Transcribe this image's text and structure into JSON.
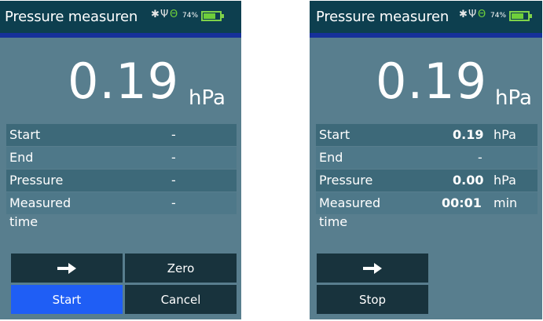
{
  "screens": [
    {
      "title": "Pressure measuren",
      "battery_percent": "74%",
      "battery_level": 0.74,
      "reading_value": "0.19",
      "reading_unit": "hPa",
      "rows": [
        {
          "label": "Start",
          "value": "-",
          "unit": ""
        },
        {
          "label": "End",
          "value": "-",
          "unit": ""
        },
        {
          "label": "Pressure",
          "value": "-",
          "unit": ""
        },
        {
          "label": "Measured",
          "value": "-",
          "unit": ""
        }
      ],
      "row_continuation": "time",
      "buttons": {
        "arrow": "arrow-right-icon",
        "zero": "Zero",
        "start": "Start",
        "cancel": "Cancel"
      }
    },
    {
      "title": "Pressure measuren",
      "battery_percent": "74%",
      "battery_level": 0.74,
      "reading_value": "0.19",
      "reading_unit": "hPa",
      "rows": [
        {
          "label": "Start",
          "value": "0.19",
          "unit": "hPa"
        },
        {
          "label": "End",
          "value": "-",
          "unit": ""
        },
        {
          "label": "Pressure",
          "value": "0.00",
          "unit": "hPa"
        },
        {
          "label": "Measured",
          "value": "00:01",
          "unit": "min"
        }
      ],
      "row_continuation": "time",
      "buttons": {
        "arrow": "arrow-right-icon",
        "stop": "Stop"
      }
    }
  ],
  "colors": {
    "screen_bg": "#587e8e",
    "titlebar": "#0d3f4f",
    "accent_bar": "#16309a",
    "button": "#18333d",
    "button_active": "#1f5ef5",
    "battery": "#6ecf3a"
  }
}
